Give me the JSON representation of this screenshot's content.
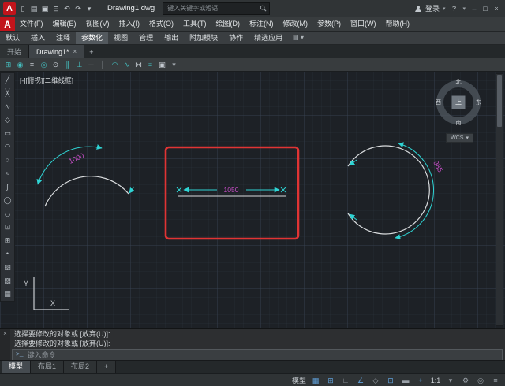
{
  "title_bar": {
    "logo_letter": "A",
    "doc_title": "Drawing1.dwg",
    "search_placeholder": "键入关键字或短语",
    "login_label": "登录",
    "help_label": "?",
    "dropdown_glyph": "▾",
    "qat_icons": [
      {
        "name": "new-file-icon",
        "glyph": "▯"
      },
      {
        "name": "open-file-icon",
        "glyph": "▤"
      },
      {
        "name": "save-icon",
        "glyph": "▣"
      },
      {
        "name": "plot-icon",
        "glyph": "⊟"
      },
      {
        "name": "undo-icon",
        "glyph": "↶"
      },
      {
        "name": "redo-icon",
        "glyph": "↷"
      },
      {
        "name": "qat-customize-icon",
        "glyph": "▾"
      }
    ],
    "window_buttons": [
      {
        "name": "minimize-button",
        "glyph": "–"
      },
      {
        "name": "maximize-button",
        "glyph": "□"
      },
      {
        "name": "close-button",
        "glyph": "×"
      }
    ]
  },
  "menu": {
    "items": [
      {
        "name": "menu-file",
        "label": "文件(F)"
      },
      {
        "name": "menu-edit",
        "label": "编辑(E)"
      },
      {
        "name": "menu-view",
        "label": "视图(V)"
      },
      {
        "name": "menu-insert",
        "label": "插入(I)"
      },
      {
        "name": "menu-format",
        "label": "格式(O)"
      },
      {
        "name": "menu-tools",
        "label": "工具(T)"
      },
      {
        "name": "menu-draw",
        "label": "绘图(D)"
      },
      {
        "name": "menu-dimension",
        "label": "标注(N)"
      },
      {
        "name": "menu-modify",
        "label": "修改(M)"
      },
      {
        "name": "menu-parametric",
        "label": "参数(P)"
      },
      {
        "name": "menu-window",
        "label": "窗口(W)"
      },
      {
        "name": "menu-help",
        "label": "帮助(H)"
      }
    ]
  },
  "ribbon": {
    "toggle_glyph": "▤ ▾",
    "tabs": [
      {
        "name": "ribbon-tab-home",
        "label": "默认"
      },
      {
        "name": "ribbon-tab-insert",
        "label": "插入"
      },
      {
        "name": "ribbon-tab-annotate",
        "label": "注释"
      },
      {
        "name": "ribbon-tab-parametric",
        "label": "参数化",
        "active": true
      },
      {
        "name": "ribbon-tab-view",
        "label": "视图"
      },
      {
        "name": "ribbon-tab-manage",
        "label": "管理"
      },
      {
        "name": "ribbon-tab-output",
        "label": "输出"
      },
      {
        "name": "ribbon-tab-addins",
        "label": "附加模块"
      },
      {
        "name": "ribbon-tab-collaborate",
        "label": "协作"
      },
      {
        "name": "ribbon-tab-featured",
        "label": "精选应用"
      }
    ]
  },
  "file_tabs": {
    "start": "开始",
    "drawing": "Drawing1*",
    "close_glyph": "×",
    "add_glyph": "+"
  },
  "toolbar": {
    "icons": [
      {
        "name": "auto-constrain-icon",
        "glyph": "⊞",
        "color": "#45c0c0"
      },
      {
        "name": "coincident-constraint-icon",
        "glyph": "◉",
        "color": "#45c0c0"
      },
      {
        "name": "collinear-constraint-icon",
        "glyph": "≡",
        "color": "#c4cad0"
      },
      {
        "name": "concentric-constraint-icon",
        "glyph": "◎",
        "color": "#45c0c0"
      },
      {
        "name": "fix-constraint-icon",
        "glyph": "⊙",
        "color": "#c4cad0"
      },
      {
        "name": "parallel-constraint-icon",
        "glyph": "∥",
        "color": "#45c0c0"
      },
      {
        "name": "perpendicular-constraint-icon",
        "glyph": "⊥",
        "color": "#45c0c0"
      },
      {
        "name": "horizontal-constraint-icon",
        "glyph": "─",
        "color": "#c4cad0"
      },
      {
        "name": "vertical-constraint-icon",
        "glyph": "│",
        "color": "#c4cad0"
      },
      {
        "name": "tangent-constraint-icon",
        "glyph": "◠",
        "color": "#45c0c0"
      },
      {
        "name": "smooth-constraint-icon",
        "glyph": "∿",
        "color": "#45c0c0"
      },
      {
        "name": "symmetric-constraint-icon",
        "glyph": "⋈",
        "color": "#c4cad0"
      },
      {
        "name": "equal-constraint-icon",
        "glyph": "=",
        "color": "#45c0c0"
      },
      {
        "name": "show-constraints-icon",
        "glyph": "▣",
        "color": "#c4cad0"
      },
      {
        "name": "toolbar-dropdown-icon",
        "glyph": "▾",
        "color": "#9aa0a6"
      }
    ]
  },
  "drawbar": {
    "icons": [
      {
        "name": "line-tool-icon",
        "glyph": "╱"
      },
      {
        "name": "construction-line-tool-icon",
        "glyph": "╳"
      },
      {
        "name": "polyline-tool-icon",
        "glyph": "∿"
      },
      {
        "name": "polygon-tool-icon",
        "glyph": "◇"
      },
      {
        "name": "rectangle-tool-icon",
        "glyph": "▭"
      },
      {
        "name": "arc-tool-icon",
        "glyph": "◠"
      },
      {
        "name": "circle-tool-icon",
        "glyph": "○"
      },
      {
        "name": "revision-cloud-tool-icon",
        "glyph": "≈"
      },
      {
        "name": "spline-tool-icon",
        "glyph": "∫"
      },
      {
        "name": "ellipse-tool-icon",
        "glyph": "◯"
      },
      {
        "name": "ellipse-arc-tool-icon",
        "glyph": "◡"
      },
      {
        "name": "insert-block-tool-icon",
        "glyph": "⊡"
      },
      {
        "name": "make-block-tool-icon",
        "glyph": "⊞"
      },
      {
        "name": "point-tool-icon",
        "glyph": "•"
      },
      {
        "name": "hatch-tool-icon",
        "glyph": "▨"
      },
      {
        "name": "gradient-tool-icon",
        "glyph": "▧"
      },
      {
        "name": "table-tool-icon",
        "glyph": "▦"
      }
    ]
  },
  "viewport": {
    "label": "[-][俯视][二维线框]",
    "wcs_label": "WCS",
    "wcs_caret": "▾",
    "compass": {
      "north": "北",
      "south": "南",
      "east": "东",
      "west": "西",
      "top": "上"
    }
  },
  "drawing": {
    "dim_left": "1000",
    "dim_middle": "1050",
    "dim_right": "985",
    "ucs_x": "X",
    "ucs_y": "Y"
  },
  "command": {
    "history": [
      "选择要修改的对象或 [放弃(U)]:",
      "选择要修改的对象或 [放弃(U)]:"
    ],
    "prompt": ">_",
    "placeholder": "键入命令",
    "close_glyph": "×"
  },
  "layout_tabs": {
    "tabs": [
      {
        "name": "layout-tab-model",
        "label": "模型",
        "active": true
      },
      {
        "name": "layout-tab-layout1",
        "label": "布局1"
      },
      {
        "name": "layout-tab-layout2",
        "label": "布局2"
      },
      {
        "name": "layout-tab-add",
        "label": "+"
      }
    ]
  },
  "status_bar": {
    "icons": [
      {
        "name": "model-space-toggle",
        "glyph": "模型",
        "color": "#ccd1d6"
      },
      {
        "name": "grid-icon",
        "glyph": "▦",
        "color": "#5f9fd8"
      },
      {
        "name": "snap-icon",
        "glyph": "⊞",
        "color": "#5f9fd8"
      },
      {
        "name": "ortho-icon",
        "glyph": "∟",
        "color": "#9aa1a8"
      },
      {
        "name": "polar-tracking-icon",
        "glyph": "∠",
        "color": "#5f9fd8"
      },
      {
        "name": "isodraft-icon",
        "glyph": "◇",
        "color": "#9aa1a8"
      },
      {
        "name": "osnap-icon",
        "glyph": "⊡",
        "color": "#5f9fd8"
      },
      {
        "name": "lineweight-icon",
        "glyph": "▬",
        "color": "#9aa1a8"
      },
      {
        "name": "dynamic-input-icon",
        "glyph": "+",
        "color": "#5f9fd8"
      },
      {
        "name": "annotation-scale-label",
        "glyph": "1:1",
        "color": "#ccd1d6"
      },
      {
        "name": "scale-dropdown-icon",
        "glyph": "▾",
        "color": "#9aa1a8"
      },
      {
        "name": "workspace-gear-icon",
        "glyph": "⚙",
        "color": "#9aa1a8"
      },
      {
        "name": "isolate-objects-icon",
        "glyph": "◎",
        "color": "#9aa1a8"
      },
      {
        "name": "customization-menu-icon",
        "glyph": "≡",
        "color": "#9aa1a8"
      }
    ]
  }
}
